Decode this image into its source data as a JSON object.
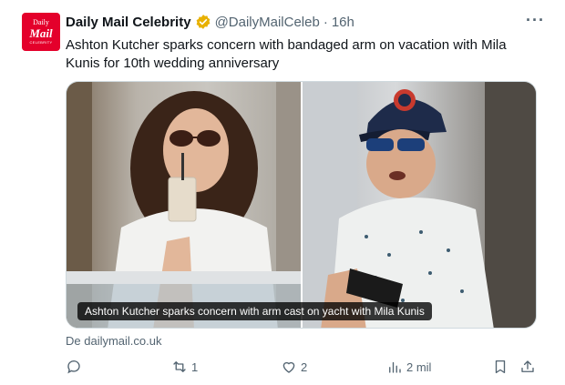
{
  "tweet": {
    "avatar": {
      "line1": "Daily",
      "line2": "Mail",
      "line3": "CELEBRITY"
    },
    "author_name": "Daily Mail Celebrity",
    "handle": "@DailyMailCeleb",
    "separator": "·",
    "time": "16h",
    "more": "···",
    "text": "Ashton Kutcher sparks concern with bandaged arm on vacation with Mila Kunis for 10th wedding anniversary",
    "media_caption": "Ashton Kutcher sparks concern with arm cast on yacht with Mila Kunis",
    "source": "De dailymail.co.uk",
    "actions": {
      "replies": "",
      "retweets": "1",
      "likes": "2",
      "views": "2 mil"
    }
  },
  "colors": {
    "brand_red": "#e4002b",
    "verified_gold": "#e8b100",
    "muted_text": "#536471",
    "text": "#0f1419"
  },
  "icons": [
    "verified-badge-icon",
    "more-icon",
    "reply-icon",
    "retweet-icon",
    "like-icon",
    "views-icon",
    "bookmark-icon",
    "share-icon"
  ]
}
